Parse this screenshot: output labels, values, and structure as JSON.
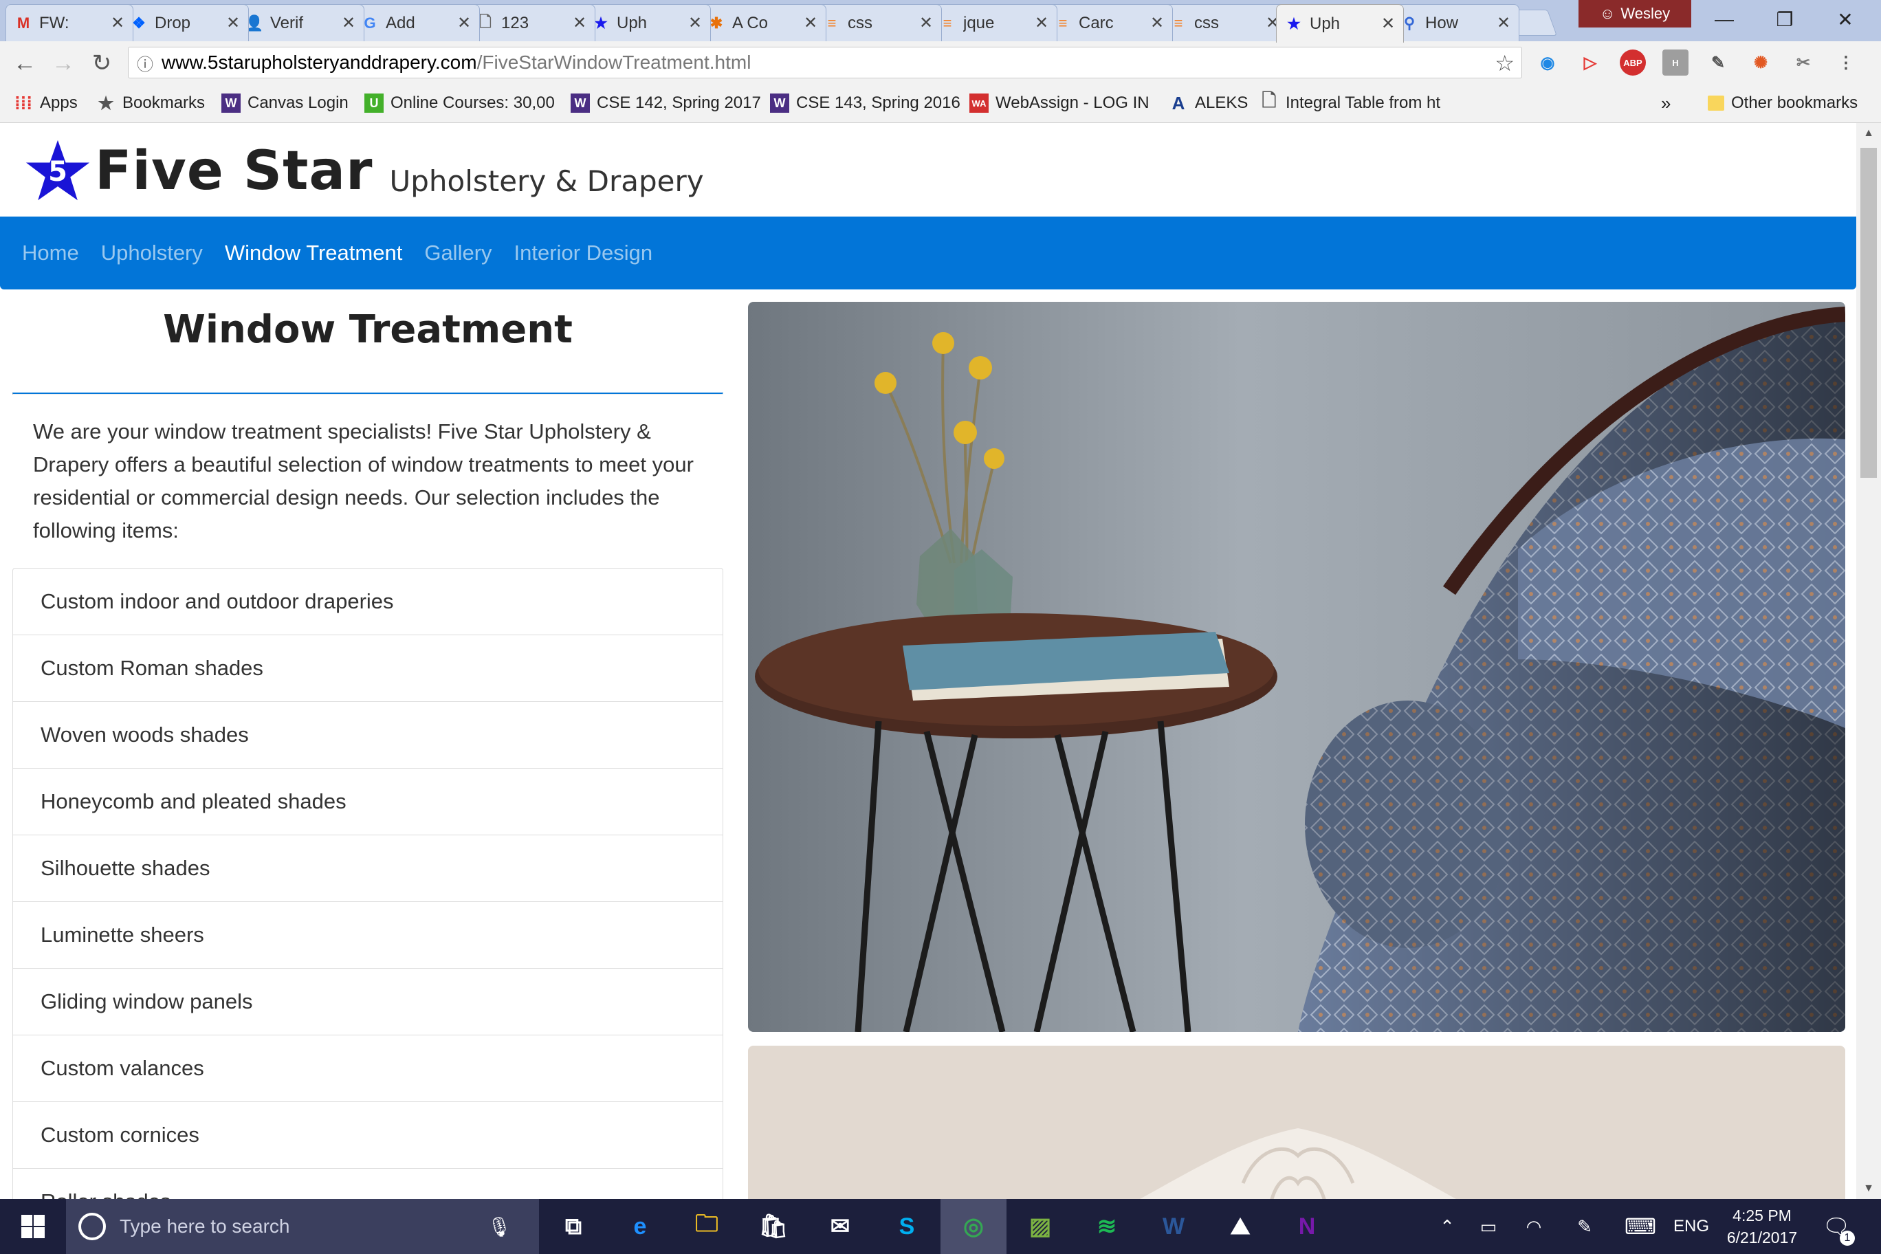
{
  "browser": {
    "tabs": [
      {
        "title": "FW:",
        "icon": "gmail-icon",
        "glyph": "M",
        "color": "#d93025"
      },
      {
        "title": "Drop",
        "icon": "dropbox-icon",
        "glyph": "❖",
        "color": "#0061fe"
      },
      {
        "title": "Verif",
        "icon": "user-icon",
        "glyph": "👤",
        "color": "#3367d6"
      },
      {
        "title": "Add",
        "icon": "google-icon",
        "glyph": "G",
        "color": "#4285f4"
      },
      {
        "title": "123",
        "icon": "document-icon",
        "glyph": "🗋",
        "color": "#666666"
      },
      {
        "title": "Uph",
        "icon": "star-icon",
        "glyph": "★",
        "color": "#1a1aee"
      },
      {
        "title": "A Co",
        "icon": "asterisk-icon",
        "glyph": "✱",
        "color": "#e8710a"
      },
      {
        "title": "css",
        "icon": "stackoverflow-icon",
        "glyph": "≡",
        "color": "#f48024"
      },
      {
        "title": "jque",
        "icon": "stackoverflow-icon",
        "glyph": "≡",
        "color": "#f48024"
      },
      {
        "title": "Carc",
        "icon": "stackoverflow-icon",
        "glyph": "≡",
        "color": "#f48024"
      },
      {
        "title": "css",
        "icon": "stackoverflow-icon",
        "glyph": "≡",
        "color": "#f48024"
      },
      {
        "title": "Uph",
        "icon": "star-icon",
        "glyph": "★",
        "color": "#1a1aee",
        "active": true
      },
      {
        "title": "How",
        "icon": "search-icon",
        "glyph": "⚲",
        "color": "#3367d6"
      }
    ],
    "tab_close": "✕",
    "profile_name": "Wesley",
    "window_controls": {
      "minimize": "—",
      "maximize": "❐",
      "close": "✕"
    },
    "nav": {
      "back": "←",
      "forward": "→",
      "reload": "↻"
    },
    "url": {
      "info": "ⓘ",
      "host": "www.5starupholsteryanddrapery.com",
      "path": "/FiveStarWindowTreatment.html"
    },
    "bookmark_star": "☆",
    "extensions": [
      {
        "name": "eye-extension-icon",
        "glyph": "◉",
        "color": "#1e88e5"
      },
      {
        "name": "play-extension-icon",
        "glyph": "▷",
        "color": "#e53935"
      },
      {
        "name": "adblock-icon",
        "glyph": "ABP",
        "color": "#ffffff",
        "bg": "#d32f2f"
      },
      {
        "name": "h-extension-icon",
        "glyph": "H",
        "color": "#ffffff",
        "bg": "#9e9e9e"
      },
      {
        "name": "eyedropper-icon",
        "glyph": "✎",
        "color": "#555555"
      },
      {
        "name": "crab-extension-icon",
        "glyph": "✺",
        "color": "#e25822"
      },
      {
        "name": "scissors-icon",
        "glyph": "✂",
        "color": "#777777"
      },
      {
        "name": "menu-icon",
        "glyph": "⋮",
        "color": "#555555"
      }
    ],
    "bookmarks": [
      {
        "label": "Apps",
        "icon": "apps-icon",
        "glyph": "⁞⁞⁞",
        "bg": "transparent",
        "fg": "#e53935"
      },
      {
        "label": "Bookmarks",
        "icon": "star-icon",
        "glyph": "★",
        "bg": "transparent",
        "fg": "#555555"
      },
      {
        "label": "Canvas Login",
        "icon": "uw-icon",
        "glyph": "W",
        "bg": "#4b2e83",
        "fg": "#ffffff"
      },
      {
        "label": "Online Courses: 30,00",
        "icon": "udemy-icon",
        "glyph": "U",
        "bg": "#43b02a",
        "fg": "#ffffff"
      },
      {
        "label": "CSE 142, Spring 2017",
        "icon": "uw-icon",
        "glyph": "W",
        "bg": "#4b2e83",
        "fg": "#ffffff"
      },
      {
        "label": "CSE 143, Spring 2016",
        "icon": "uw-icon",
        "glyph": "W",
        "bg": "#4b2e83",
        "fg": "#ffffff"
      },
      {
        "label": "WebAssign - LOG IN",
        "icon": "webassign-icon",
        "glyph": "WA",
        "bg": "#d32f2f",
        "fg": "#ffffff"
      },
      {
        "label": "ALEKS",
        "icon": "aleks-icon",
        "glyph": "A",
        "bg": "transparent",
        "fg": "#1a3e8f"
      },
      {
        "label": "Integral Table from ht",
        "icon": "document-icon",
        "glyph": "🗋",
        "bg": "transparent",
        "fg": "#555555"
      }
    ],
    "bookmarks_overflow": "»",
    "other_bookmarks": "Other bookmarks",
    "scroll_up": "▲",
    "scroll_down": "▼"
  },
  "site": {
    "brand_number": "5",
    "brand_name": "Five Star",
    "brand_tagline": "Upholstery & Drapery",
    "nav": [
      "Home",
      "Upholstery",
      "Window Treatment",
      "Gallery",
      "Interior Design"
    ],
    "nav_active": "Window Treatment",
    "page_title": "Window Treatment",
    "intro": "We are your window treatment specialists! Five Star Upholstery & Drapery offers a beautiful selection of window treatments to meet your residential or commercial design needs. Our selection includes the following items:",
    "items": [
      "Custom indoor and outdoor draperies",
      "Custom Roman shades",
      "Woven woods shades",
      "Honeycomb and pleated shades",
      "Silhouette shades",
      "Luminette sheers",
      "Gliding window panels",
      "Custom valances",
      "Custom cornices",
      "Roller shades"
    ],
    "accent_color": "#0275d8"
  },
  "taskbar": {
    "search_placeholder": "Type here to search",
    "apps": [
      {
        "name": "task-view-icon",
        "glyph": "⧉",
        "color": "#ffffff"
      },
      {
        "name": "edge-icon",
        "glyph": "e",
        "color": "#1e90ff"
      },
      {
        "name": "file-explorer-icon",
        "glyph": "🗀",
        "color": "#f9c623"
      },
      {
        "name": "store-icon",
        "glyph": "🛍",
        "color": "#ffffff"
      },
      {
        "name": "mail-icon",
        "glyph": "✉",
        "color": "#ffffff"
      },
      {
        "name": "skype-icon",
        "glyph": "S",
        "color": "#00aff0"
      },
      {
        "name": "chrome-icon",
        "glyph": "◎",
        "color": "#34a853",
        "active": true
      },
      {
        "name": "image-editor-icon",
        "glyph": "▨",
        "color": "#7cb342"
      },
      {
        "name": "spotify-icon",
        "glyph": "≋",
        "color": "#1db954"
      },
      {
        "name": "word-icon",
        "glyph": "W",
        "color": "#2b579a"
      },
      {
        "name": "photos-icon",
        "glyph": "⛰",
        "color": "#ffffff"
      },
      {
        "name": "onenote-icon",
        "glyph": "N",
        "color": "#7719aa"
      }
    ],
    "tray": {
      "up_arrow": "⌃",
      "battery": "▭",
      "wifi": "◠",
      "pen": "✎",
      "keyboard": "⌨",
      "language": "ENG",
      "notifications": "🗨"
    },
    "time": "4:25 PM",
    "date": "6/21/2017",
    "notification_count": "1"
  }
}
